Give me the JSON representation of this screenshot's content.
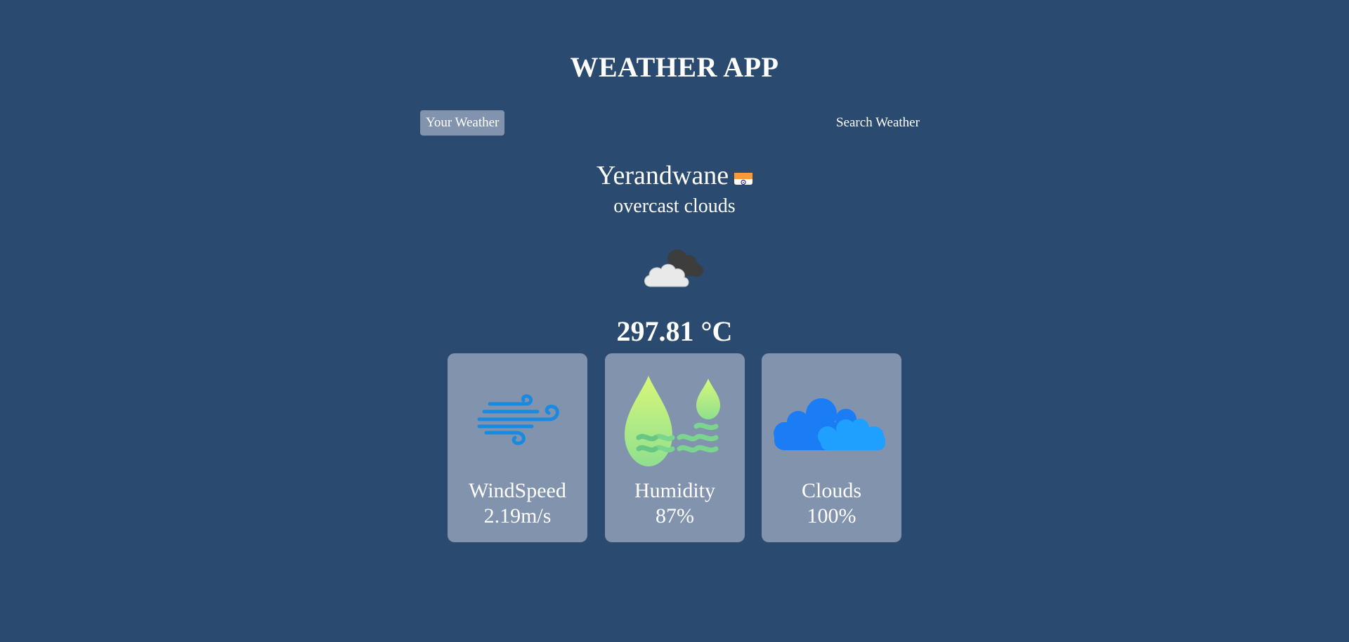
{
  "app": {
    "title": "WEATHER APP"
  },
  "tabs": {
    "your_weather": "Your Weather",
    "search_weather": "Search Weather"
  },
  "location": {
    "city": "Yerandwane",
    "flag_icon": "india-flag-icon"
  },
  "weather": {
    "description": "overcast clouds",
    "icon": "overcast-clouds-icon",
    "temperature": "297.81 °C"
  },
  "cards": {
    "wind": {
      "icon": "wind-icon",
      "label": "WindSpeed",
      "value": "2.19m/s"
    },
    "humidity": {
      "icon": "humidity-icon",
      "label": "Humidity",
      "value": "87%"
    },
    "clouds": {
      "icon": "clouds-icon",
      "label": "Clouds",
      "value": "100%"
    }
  },
  "colors": {
    "background": "#2a4a6f",
    "card": "#8293ae",
    "active_tab": "#8293ae",
    "text": "#ffffff"
  }
}
